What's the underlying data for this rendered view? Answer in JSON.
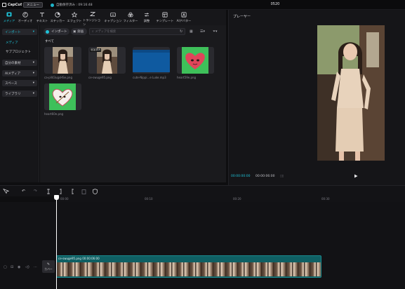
{
  "app": {
    "logo_text": "CapCut",
    "menu_label": "メニュー",
    "autosave_text": "自動保存済み : 09:16:48",
    "project_title": "0520"
  },
  "toolbar": {
    "tools": [
      {
        "label": "メディア",
        "icon": "media-icon",
        "active": true
      },
      {
        "label": "オーディオ",
        "icon": "audio-icon"
      },
      {
        "label": "テキスト",
        "icon": "text-icon"
      },
      {
        "label": "ステッカー",
        "icon": "sticker-icon"
      },
      {
        "label": "エフェクト",
        "icon": "effects-icon"
      },
      {
        "label": "トランジション",
        "icon": "transition-icon"
      },
      {
        "label": "キャプション",
        "icon": "caption-icon"
      },
      {
        "label": "フィルター",
        "icon": "filter-icon"
      },
      {
        "label": "調整",
        "icon": "adjust-icon"
      },
      {
        "label": "テンプレート",
        "icon": "template-icon"
      },
      {
        "label": "AIアバター",
        "icon": "ai-avatar-icon"
      }
    ]
  },
  "left_nav": {
    "import_label": "インポート",
    "media_label": "メディア",
    "subproject_label": "サブプロジェクト",
    "own_material_label": "自分の素材",
    "ai_media_label": "AIメディア",
    "spaces_label": "スペース",
    "library_label": "ライブラリ"
  },
  "media_toolbar": {
    "import_label": "インポート",
    "record_label": "録画",
    "search_placeholder": "メディアを検索",
    "all_label": "すべて"
  },
  "media_items": [
    {
      "name": "ca-pll43ugsHSe.png",
      "badge": "",
      "kind": "photo-girl"
    },
    {
      "name": "ce-swuge95.png",
      "badge": "追加済み",
      "kind": "photo-girl2"
    },
    {
      "name": "cute-Nippi...e Luke.mp3",
      "badge": "",
      "kind": "audio"
    },
    {
      "name": "heart59e.png",
      "badge": "",
      "kind": "heart"
    },
    {
      "name": "heart60e.png",
      "badge": "",
      "kind": "heart2"
    }
  ],
  "player": {
    "title": "プレーヤー",
    "time_current": "00:00:00:00",
    "time_total": "00:00:06:00"
  },
  "timeline": {
    "ruler_labels": [
      "00:00",
      "00:10",
      "00:20",
      "00:30"
    ],
    "clip_label": "ce-swuge95.png  00:00:06:00",
    "cover_label": "カバー"
  },
  "colors": {
    "accent": "#1fc3d8",
    "clip_bg": "#0f5f63",
    "heart_green": "#3ec05a",
    "heart_red": "#e0455a"
  }
}
